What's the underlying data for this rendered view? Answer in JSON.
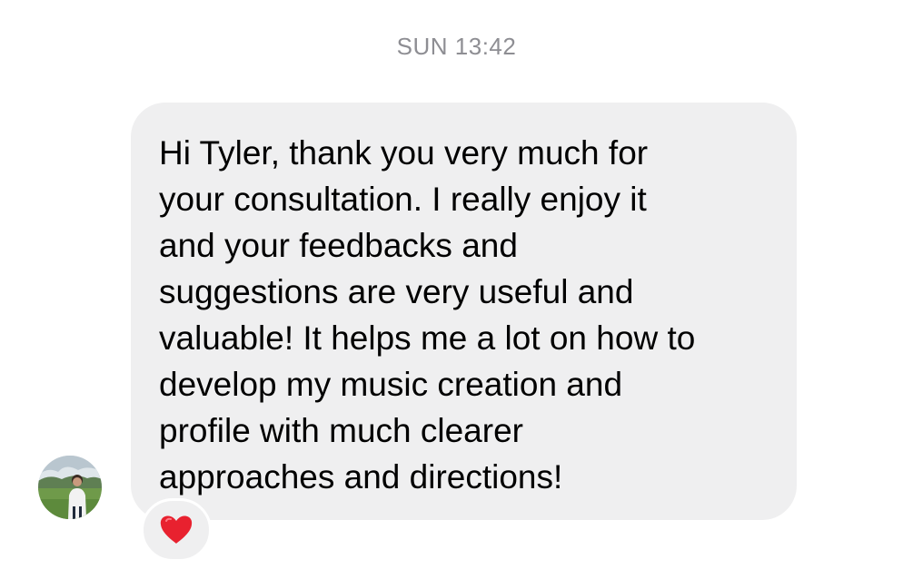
{
  "thread": {
    "timestamp": "SUN 13:42"
  },
  "message": {
    "sender_avatar": "user-photo",
    "text": "Hi Tyler, thank you very much for\nyour consultation. I really enjoy it\nand your feedbacks and\nsuggestions are very useful and\nvaluable! It helps me a lot on how to\ndevelop my music creation and\nprofile with much clearer\napproaches and directions!",
    "bubble_color": "#efeff0",
    "reaction": {
      "icon": "heart-icon",
      "color": "#e8212f"
    }
  }
}
